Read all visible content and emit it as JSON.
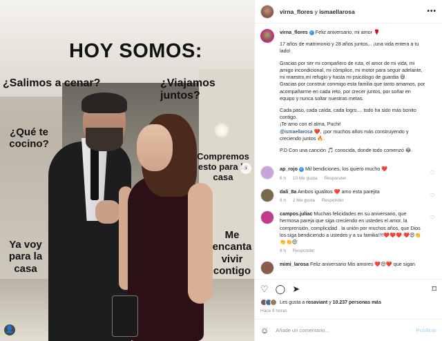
{
  "image": {
    "headline": "HOY SOMOS:",
    "phrases": {
      "p1": "¿Salimos a cenar?",
      "p2": "¿Viajamos juntos?",
      "p3": "¿Qué te cocino?",
      "p4": "Compremos esto para la casa",
      "p5": "Ya voy para la casa",
      "p6": "Me encanta vivir contigo"
    },
    "nav_glyph": "›",
    "user_glyph": "👤"
  },
  "header": {
    "username": "virna_flores",
    "joiner": " y ",
    "collab": "ismaellarosa",
    "more": "•••"
  },
  "caption": {
    "username": "virna_flores",
    "verified_glyph": "✓",
    "first_line": "Feliz aniversario, mi amor 🌹",
    "para1": "17 años de matrimonio y 28 años juntos... ¡una vida entera a tu lado!",
    "para2": "Gracias por ser mi compañero de ruta, el amor de mi vida, mi amigo incondicional, mi cómplice, mi motor para seguir adelante, mi maestro,mi refugio y hasta mi psicólogo de guardia 😅.",
    "para3": "Gracias por construir conmigo esta familia que tanto amamos, por acompañarme en cada reto, por crecer juntos, por soñar en equipo y nunca soltar nuestras metas.",
    "para4": "Cada paso, cada caída, cada logro.... todo ha sido más bonito contigo.",
    "para5": "¡Te amo con el alma, Puchi!",
    "mention": "@ismaellarosa",
    "para6_rest": " ❤️, ¡por muchos años más construyendo y creciendo juntos 🔥.",
    "para7": "P.D Con una canción 🎵 conocida, donde todo comenzó 😂."
  },
  "comments": [
    {
      "user": "ap_rojo",
      "verified": "✓",
      "text": "Mil bendiciones, los quiero mucho ❤️",
      "time": "6 h",
      "likes": "10 Me gusta",
      "reply": "Responder",
      "color": "#c9a4d6"
    },
    {
      "user": "dali_8a",
      "verified": "",
      "text": "Ambos igualitos ❤️ amo esta parejita",
      "time": "8 h",
      "likes": "2 Me gusta",
      "reply": "Responder",
      "color": "#7a6a4a"
    },
    {
      "user": "campos.juliac",
      "verified": "",
      "text": "Muchas felicidades en su aniversario, que hermosa pareja que siga creciendo en ustedes el amor, la comprensión, complicidad . la unión por muchos años, que Dios los siga bendiciendo a ustedes y a su familia!!!!❤️❤️❤️ ❤️😍👏👏👏😍",
      "time": "8 h",
      "likes": "",
      "reply": "Responder",
      "color": "#c23a8a"
    },
    {
      "user": "mimi_larosa",
      "verified": "",
      "text": "Feliz aniversario Mis amores ❤️😍❤️ que sigan",
      "time": "",
      "likes": "",
      "reply": "",
      "color": "#8a5a4a"
    }
  ],
  "actions": {
    "like_icon": "♡",
    "comment_icon": "◯",
    "share_icon": "➤",
    "save_icon": "⌑"
  },
  "likes": {
    "prefix": "Les gusta a ",
    "user": "rosaviant",
    "middle": " y ",
    "count": "10.237 personas más"
  },
  "time_ago": "Hace 8 horas",
  "add_comment": {
    "emoji_icon": "☺",
    "placeholder": "Añade un comentario...",
    "publish": "Publicar"
  }
}
